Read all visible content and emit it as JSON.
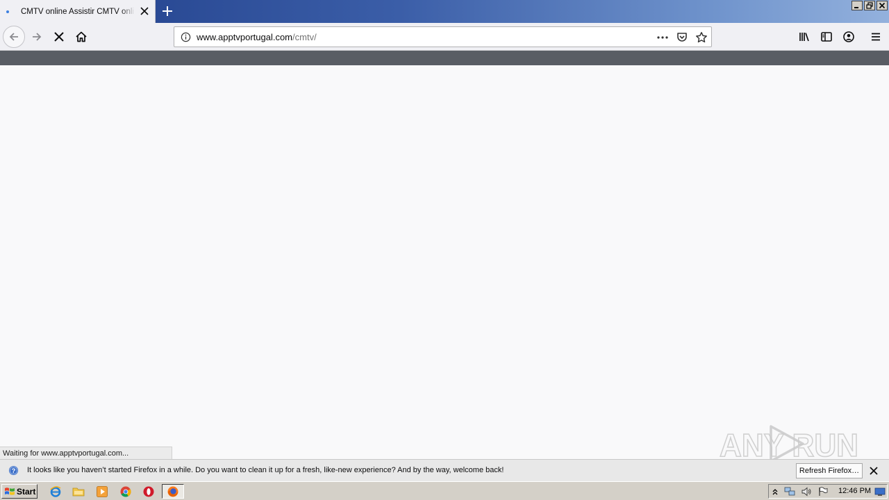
{
  "browser": {
    "tab": {
      "title": "CMTV online Assistir CMTV online n"
    },
    "url": {
      "host": "www.apptvportugal.com",
      "path": "/cmtv/"
    }
  },
  "status_text": "Waiting for www.apptvportugal.com...",
  "notification": {
    "message": "It looks like you haven’t started Firefox in a while. Do you want to clean it up for a fresh, like-new experience? And by the way, welcome back!",
    "button_label": "Refresh Firefox…"
  },
  "watermark": {
    "text": "ANY RUN"
  },
  "taskbar": {
    "start_label": "Start",
    "clock": "12:46 PM"
  },
  "colors": {
    "accent": "#3c7fe0",
    "toolbar_strip": "#595d64",
    "content_bg": "#f9f9fa"
  }
}
